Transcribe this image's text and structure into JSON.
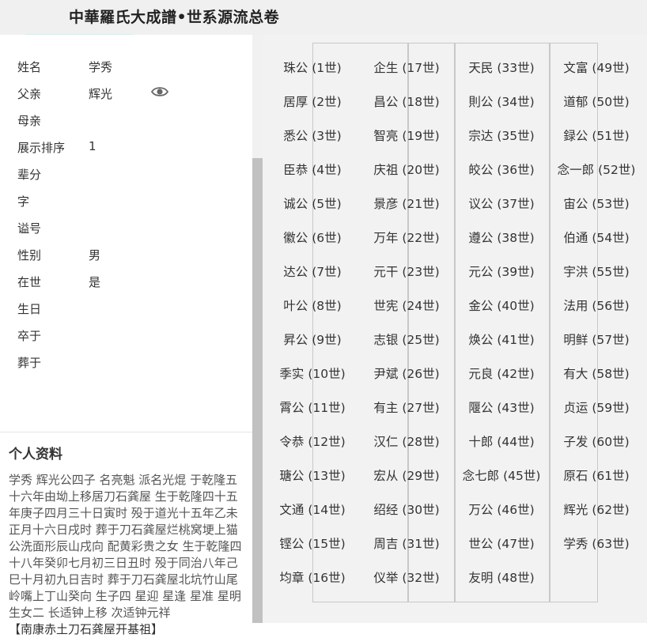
{
  "header": {
    "title": "中華羅氏大成譜•世系源流总卷"
  },
  "person": {
    "fields": [
      {
        "label": "姓名",
        "value": "学秀"
      },
      {
        "label": "父亲",
        "value": "辉光"
      },
      {
        "label": "母亲",
        "value": ""
      },
      {
        "label": "展示排序",
        "value": "1"
      },
      {
        "label": "辈分",
        "value": ""
      },
      {
        "label": "字",
        "value": ""
      },
      {
        "label": "谥号",
        "value": ""
      },
      {
        "label": "性别",
        "value": "男"
      },
      {
        "label": "在世",
        "value": "是"
      },
      {
        "label": "生日",
        "value": ""
      },
      {
        "label": "卒于",
        "value": ""
      },
      {
        "label": "葬于",
        "value": ""
      }
    ],
    "view_icon": "eye-icon"
  },
  "bio": {
    "title": "个人资料",
    "text": "学秀 辉光公四子 名亮魁 派名光焜 于乾隆五十六年由坳上移居刀石龚屋 生于乾隆四十五年庚子四月三十日寅时 殁于道光十五年乙未正月十六日戌时 葬于刀石龚屋烂桃窝埂上猫公洗面形辰山戌向 配黄彩贵之女 生于乾隆四十八年癸卯七月初三日丑时 殁于同治八年己巳十月初九日吉时 葬于刀石龚屋北坑竹山尾岭嘴上丁山癸向 生子四 星迎 星逢 星准 星明 生女二 长适钟上移 次适钟元祥",
    "origin": "【南康赤土刀石龚屋开基祖】"
  },
  "generations": [
    {
      "name": "珠公",
      "gen": "(1世)"
    },
    {
      "name": "居厚",
      "gen": "(2世)"
    },
    {
      "name": "悉公",
      "gen": "(3世)"
    },
    {
      "name": "臣恭",
      "gen": "(4世)"
    },
    {
      "name": "诚公",
      "gen": "(5世)"
    },
    {
      "name": "徽公",
      "gen": "(6世)"
    },
    {
      "name": "达公",
      "gen": "(7世)"
    },
    {
      "name": "叶公",
      "gen": "(8世)"
    },
    {
      "name": "昇公",
      "gen": "(9世)"
    },
    {
      "name": "季实",
      "gen": "(10世)"
    },
    {
      "name": "霄公",
      "gen": "(11世)"
    },
    {
      "name": "令恭",
      "gen": "(12世)"
    },
    {
      "name": "瑭公",
      "gen": "(13世)"
    },
    {
      "name": "文通",
      "gen": "(14世)"
    },
    {
      "name": "铿公",
      "gen": "(15世)"
    },
    {
      "name": "均章",
      "gen": "(16世)"
    },
    {
      "name": "企生",
      "gen": "(17世)"
    },
    {
      "name": "昌公",
      "gen": "(18世)"
    },
    {
      "name": "智亮",
      "gen": "(19世)"
    },
    {
      "name": "庆祖",
      "gen": "(20世)"
    },
    {
      "name": "景彦",
      "gen": "(21世)"
    },
    {
      "name": "万年",
      "gen": "(22世)"
    },
    {
      "name": "元干",
      "gen": "(23世)"
    },
    {
      "name": "世宪",
      "gen": "(24世)"
    },
    {
      "name": "志银",
      "gen": "(25世)"
    },
    {
      "name": "尹斌",
      "gen": "(26世)"
    },
    {
      "name": "有主",
      "gen": "(27世)"
    },
    {
      "name": "汉仁",
      "gen": "(28世)"
    },
    {
      "name": "宏从",
      "gen": "(29世)"
    },
    {
      "name": "绍经",
      "gen": "(30世)"
    },
    {
      "name": "周吉",
      "gen": "(31世)"
    },
    {
      "name": "仪举",
      "gen": "(32世)"
    },
    {
      "name": "天民",
      "gen": "(33世)"
    },
    {
      "name": "則公",
      "gen": "(34世)"
    },
    {
      "name": "宗达",
      "gen": "(35世)"
    },
    {
      "name": "皎公",
      "gen": "(36世)"
    },
    {
      "name": "议公",
      "gen": "(37世)"
    },
    {
      "name": "遵公",
      "gen": "(38世)"
    },
    {
      "name": "元公",
      "gen": "(39世)"
    },
    {
      "name": "金公",
      "gen": "(40世)"
    },
    {
      "name": "焕公",
      "gen": "(41世)"
    },
    {
      "name": "元良",
      "gen": "(42世)"
    },
    {
      "name": "隁公",
      "gen": "(43世)"
    },
    {
      "name": "十郎",
      "gen": "(44世)"
    },
    {
      "name": "念七郎",
      "gen": "(45世)"
    },
    {
      "name": "万公",
      "gen": "(46世)"
    },
    {
      "name": "世公",
      "gen": "(47世)"
    },
    {
      "name": "友明",
      "gen": "(48世)"
    },
    {
      "name": "文富",
      "gen": "(49世)"
    },
    {
      "name": "道郁",
      "gen": "(50世)"
    },
    {
      "name": "録公",
      "gen": "(51世)"
    },
    {
      "name": "念一郎",
      "gen": "(52世)"
    },
    {
      "name": "宙公",
      "gen": "(53世)"
    },
    {
      "name": "伯通",
      "gen": "(54世)"
    },
    {
      "name": "宇洪",
      "gen": "(55世)"
    },
    {
      "name": "法用",
      "gen": "(56世)"
    },
    {
      "name": "明鲜",
      "gen": "(57世)"
    },
    {
      "name": "有大",
      "gen": "(58世)"
    },
    {
      "name": "贞运",
      "gen": "(59世)"
    },
    {
      "name": "子发",
      "gen": "(60世)"
    },
    {
      "name": "原石",
      "gen": "(61世)"
    },
    {
      "name": "辉光",
      "gen": "(62世)"
    },
    {
      "name": "学秀",
      "gen": "(63世)"
    }
  ]
}
